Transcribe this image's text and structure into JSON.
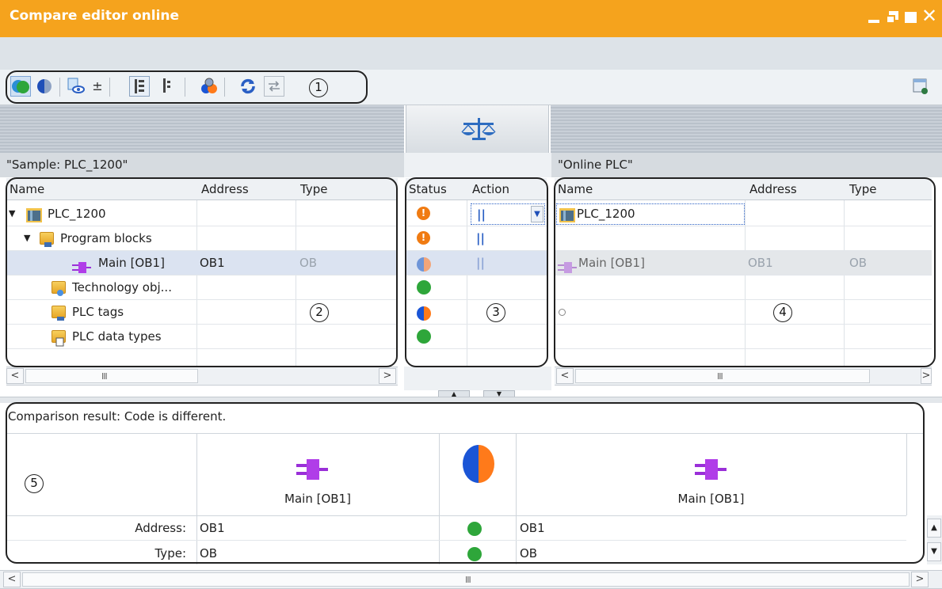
{
  "window": {
    "title": "Compare editor online"
  },
  "callouts": [
    "1",
    "2",
    "3",
    "4",
    "5"
  ],
  "left": {
    "label": "\"Sample: PLC_1200\"",
    "columns": [
      "Name",
      "Address",
      "Type"
    ],
    "rows": [
      {
        "name": "PLC_1200",
        "address": "",
        "type": ""
      },
      {
        "name": "Program blocks",
        "address": "",
        "type": ""
      },
      {
        "name": "Main [OB1]",
        "address": "OB1",
        "type": "OB"
      },
      {
        "name": "Technology obj...",
        "address": "",
        "type": ""
      },
      {
        "name": "PLC tags",
        "address": "",
        "type": ""
      },
      {
        "name": "PLC data types",
        "address": "",
        "type": ""
      }
    ]
  },
  "middle": {
    "columns": [
      "Status",
      "Action"
    ],
    "rows": [
      {
        "status": "warning",
        "action": "no-action"
      },
      {
        "status": "warning",
        "action": "no-action"
      },
      {
        "status": "different",
        "action": "no-action"
      },
      {
        "status": "identical",
        "action": ""
      },
      {
        "status": "different",
        "action": ""
      },
      {
        "status": "identical",
        "action": ""
      }
    ]
  },
  "right": {
    "label": "\"Online PLC\"",
    "columns": [
      "Name",
      "Address",
      "Type"
    ],
    "rows": [
      {
        "name": "PLC_1200",
        "address": "",
        "type": ""
      },
      {
        "name": "",
        "address": "",
        "type": ""
      },
      {
        "name": "Main [OB1]",
        "address": "OB1",
        "type": "OB"
      },
      {
        "name": "",
        "address": "",
        "type": ""
      },
      {
        "name": "",
        "address": "",
        "type": ""
      },
      {
        "name": "",
        "address": "",
        "type": ""
      }
    ]
  },
  "scroll_grip": "III",
  "result": {
    "summary": "Comparison result: Code is different.",
    "left_object": "Main [OB1]",
    "right_object": "Main [OB1]",
    "rows": [
      {
        "label": "Address:",
        "left": "OB1",
        "right": "OB1"
      },
      {
        "label": "Type:",
        "left": "OB",
        "right": "OB"
      }
    ]
  },
  "colors": {
    "titlebar": "#f5a31d",
    "warning": "#f07b12",
    "identical": "#2ea63a",
    "different_left": "#1a55d6",
    "different_right": "#ff7a1a",
    "accent_blue": "#2a5fc4"
  }
}
